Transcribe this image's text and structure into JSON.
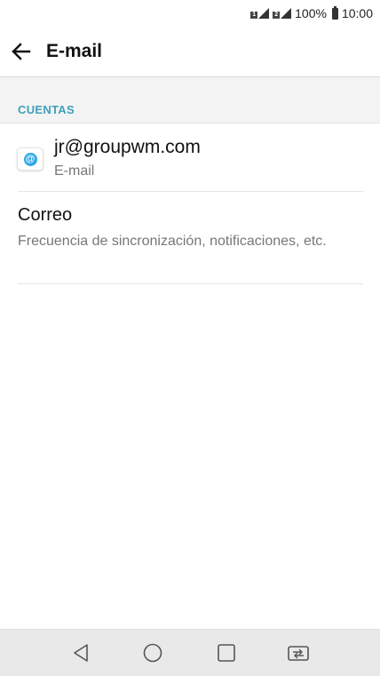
{
  "status_bar": {
    "battery": "100%",
    "time": "10:00"
  },
  "app_bar": {
    "title": "E-mail"
  },
  "section": {
    "title": "CUENTAS"
  },
  "account": {
    "email": "jr@groupwm.com",
    "type": "E-mail"
  },
  "mail_settings": {
    "title": "Correo",
    "summary": "Frecuencia de sincronización, notificaciones, etc."
  },
  "colors": {
    "accent": "#3f9fb8",
    "icon_blue": "#2fa7e8",
    "nav_bar": "#e9e9e9"
  },
  "icons": [
    "back-arrow-icon",
    "email-at-icon",
    "back-triangle-icon",
    "home-circle-icon",
    "recents-square-icon",
    "dual-window-icon"
  ]
}
